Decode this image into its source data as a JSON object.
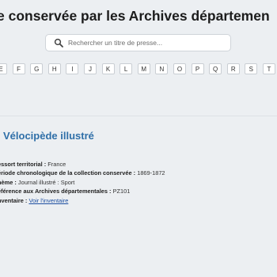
{
  "header": {
    "title": "e conservée par les Archives départemen"
  },
  "search": {
    "placeholder": "Rechercher un titre de presse..."
  },
  "alphabet": [
    "E",
    "F",
    "G",
    "H",
    "I",
    "J",
    "K",
    "L",
    "M",
    "N",
    "O",
    "P",
    "Q",
    "R",
    "S",
    "T"
  ],
  "record": {
    "title": "Vélocipède illustré",
    "fields": [
      {
        "label": "essort territorial :",
        "value": "France"
      },
      {
        "label": "ériode chronologique de la collection conservée :",
        "value": "1869-1872"
      },
      {
        "label": "hème :",
        "value": "Journal illustré : Sport"
      },
      {
        "label": "éférence aux Archives départementales :",
        "value": "PZ101"
      },
      {
        "label": "nventaire :",
        "value": "Voir l'inventaire",
        "link": true
      }
    ]
  },
  "icons": {
    "search": "search-icon"
  },
  "colors": {
    "accent": "#2f6fa8",
    "link": "#1d4fa1",
    "background": "#eceff2"
  }
}
